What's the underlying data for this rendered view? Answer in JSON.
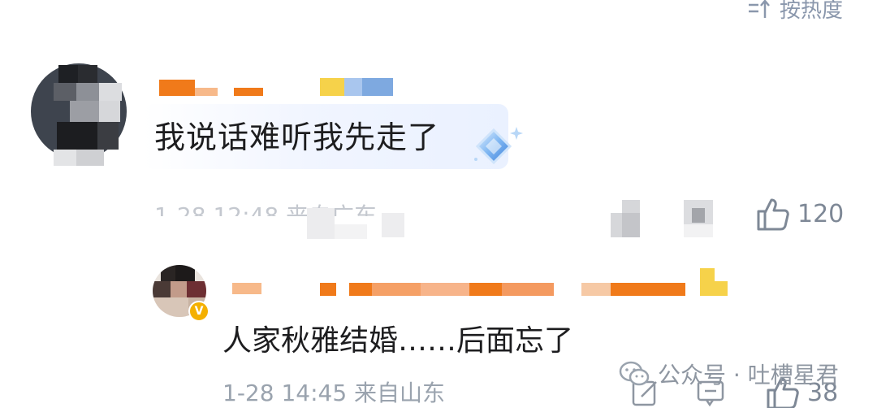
{
  "header": {
    "sort_label": "按热度"
  },
  "comments": [
    {
      "text": "我说话难听我先走了",
      "meta": "1-28 12:48 来自广东",
      "likes": "120",
      "badge": "diamond-badge"
    }
  ],
  "reply": {
    "text": "人家秋雅结婚……后面忘了",
    "meta": "1-28 14:45  来自山东",
    "likes": "38",
    "verified_mark": "V"
  },
  "watermark": {
    "text": "公众号 · 吐槽星君"
  },
  "colors": {
    "accent_orange": "#f07a1a",
    "accent_yellow": "#f6d24a",
    "accent_blue": "#9fc0ea",
    "meta_gray": "#9aa3ae",
    "icon_gray": "#7e8896"
  }
}
